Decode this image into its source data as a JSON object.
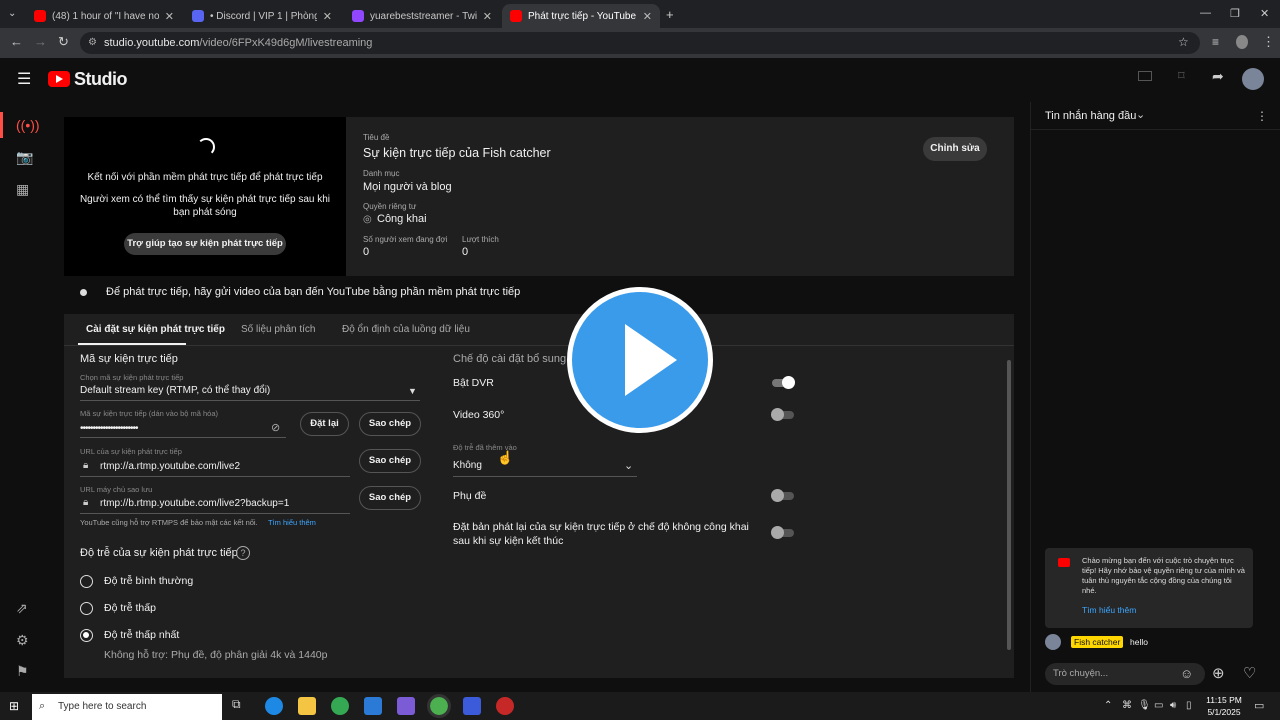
{
  "browser": {
    "tabs": [
      {
        "title": "(48) 1 hour of \"I have no enemi",
        "color": "#ff0000"
      },
      {
        "title": "• Discord | VIP 1 | Phòng đấ",
        "color": "#5865f2"
      },
      {
        "title": "yuarebeststreamer - Twitch",
        "color": "#9146ff"
      },
      {
        "title": "Phát trực tiếp - YouTube Studio",
        "color": "#ff0000"
      }
    ],
    "url_host": "studio.youtube.com",
    "url_path": "/video/6FPxK49d6gM/livestreaming"
  },
  "header": {
    "studio_label": "Studio"
  },
  "preview": {
    "connect_text": "Kết nối với phần mềm phát trực tiếp để phát trực tiếp",
    "viewers_text": "Người xem có thể tìm thấy sự kiện phát trực tiếp sau khi bạn phát sóng",
    "help_button": "Trợ giúp tạo sự kiện phát trực tiếp"
  },
  "info": {
    "title_label": "Tiêu đề",
    "title_value": "Sự kiện trực tiếp của Fish catcher",
    "category_label": "Danh mục",
    "category_value": "Mọi người và blog",
    "privacy_label": "Quyền riêng tư",
    "privacy_value": "Công khai",
    "waiting_label": "Số người xem đang đợi",
    "waiting_value": "0",
    "likes_label": "Lượt thích",
    "likes_value": "0",
    "edit_button": "Chỉnh sửa"
  },
  "status": {
    "message": "Để phát trực tiếp, hãy gửi video của bạn đến YouTube bằng phần mềm phát trực tiếp"
  },
  "tabs": [
    "Cài đặt sự kiện phát trực tiếp",
    "Số liệu phân tích",
    "Độ ổn định của luồng dữ liệu"
  ],
  "stream_key": {
    "section_title": "Mã sự kiện trực tiếp",
    "select_label": "Chọn mã sự kiện phát trực tiếp",
    "select_value": "Default stream key (RTMP, có thể thay đổi)",
    "key_label": "Mã sự kiện trực tiếp (dán vào bộ mã hóa)",
    "key_value": "•••••••••••••••••••••••",
    "reset_button": "Đặt lại",
    "copy_button": "Sao chép",
    "url_label": "URL của sự kiện phát trực tiếp",
    "url_value": "rtmp://a.rtmp.youtube.com/live2",
    "backup_label": "URL máy chủ sao lưu",
    "backup_value": "rtmp://b.rtmp.youtube.com/live2?backup=1",
    "rtmps_note": "YouTube cũng hỗ trợ RTMPS để bảo mật các kết nối.",
    "learn_more": "Tìm hiểu thêm"
  },
  "latency": {
    "title": "Độ trễ của sự kiện phát trực tiếp",
    "options": [
      "Độ trễ bình thường",
      "Độ trễ thấp",
      "Độ trễ thấp nhất"
    ],
    "selected_index": 2,
    "note": "Không hỗ trợ: Phụ đề, độ phân giải 4k và 1440p"
  },
  "additional": {
    "title": "Chế độ cài đặt bổ sung",
    "dvr_label": "Bật DVR",
    "dvr_on": true,
    "video360_label": "Video 360°",
    "video360_on": false,
    "delay_label": "Độ trễ đã thêm vào",
    "delay_value": "Không",
    "captions_label": "Phụ đề",
    "captions_on": false,
    "unlisted_label": "Đặt bản phát lại của sự kiện trực tiếp ở chế độ không công khai sau khi sự kiện kết thúc",
    "unlisted_on": false
  },
  "chat": {
    "header": "Tin nhắn hàng đầu",
    "notice": "Chào mừng bạn đến với cuộc trò chuyện trực tiếp! Hãy nhớ bảo vệ quyền riêng tư của mình và tuân thủ nguyên tắc cộng đồng của chúng tôi nhé.",
    "notice_link": "Tìm hiểu thêm",
    "message_author": "Fish catcher",
    "message_text": "hello",
    "input_placeholder": "Trò chuyện..."
  },
  "taskbar": {
    "search_placeholder": "Type here to search",
    "time": "11:15 PM",
    "date": "5/1/2025"
  }
}
